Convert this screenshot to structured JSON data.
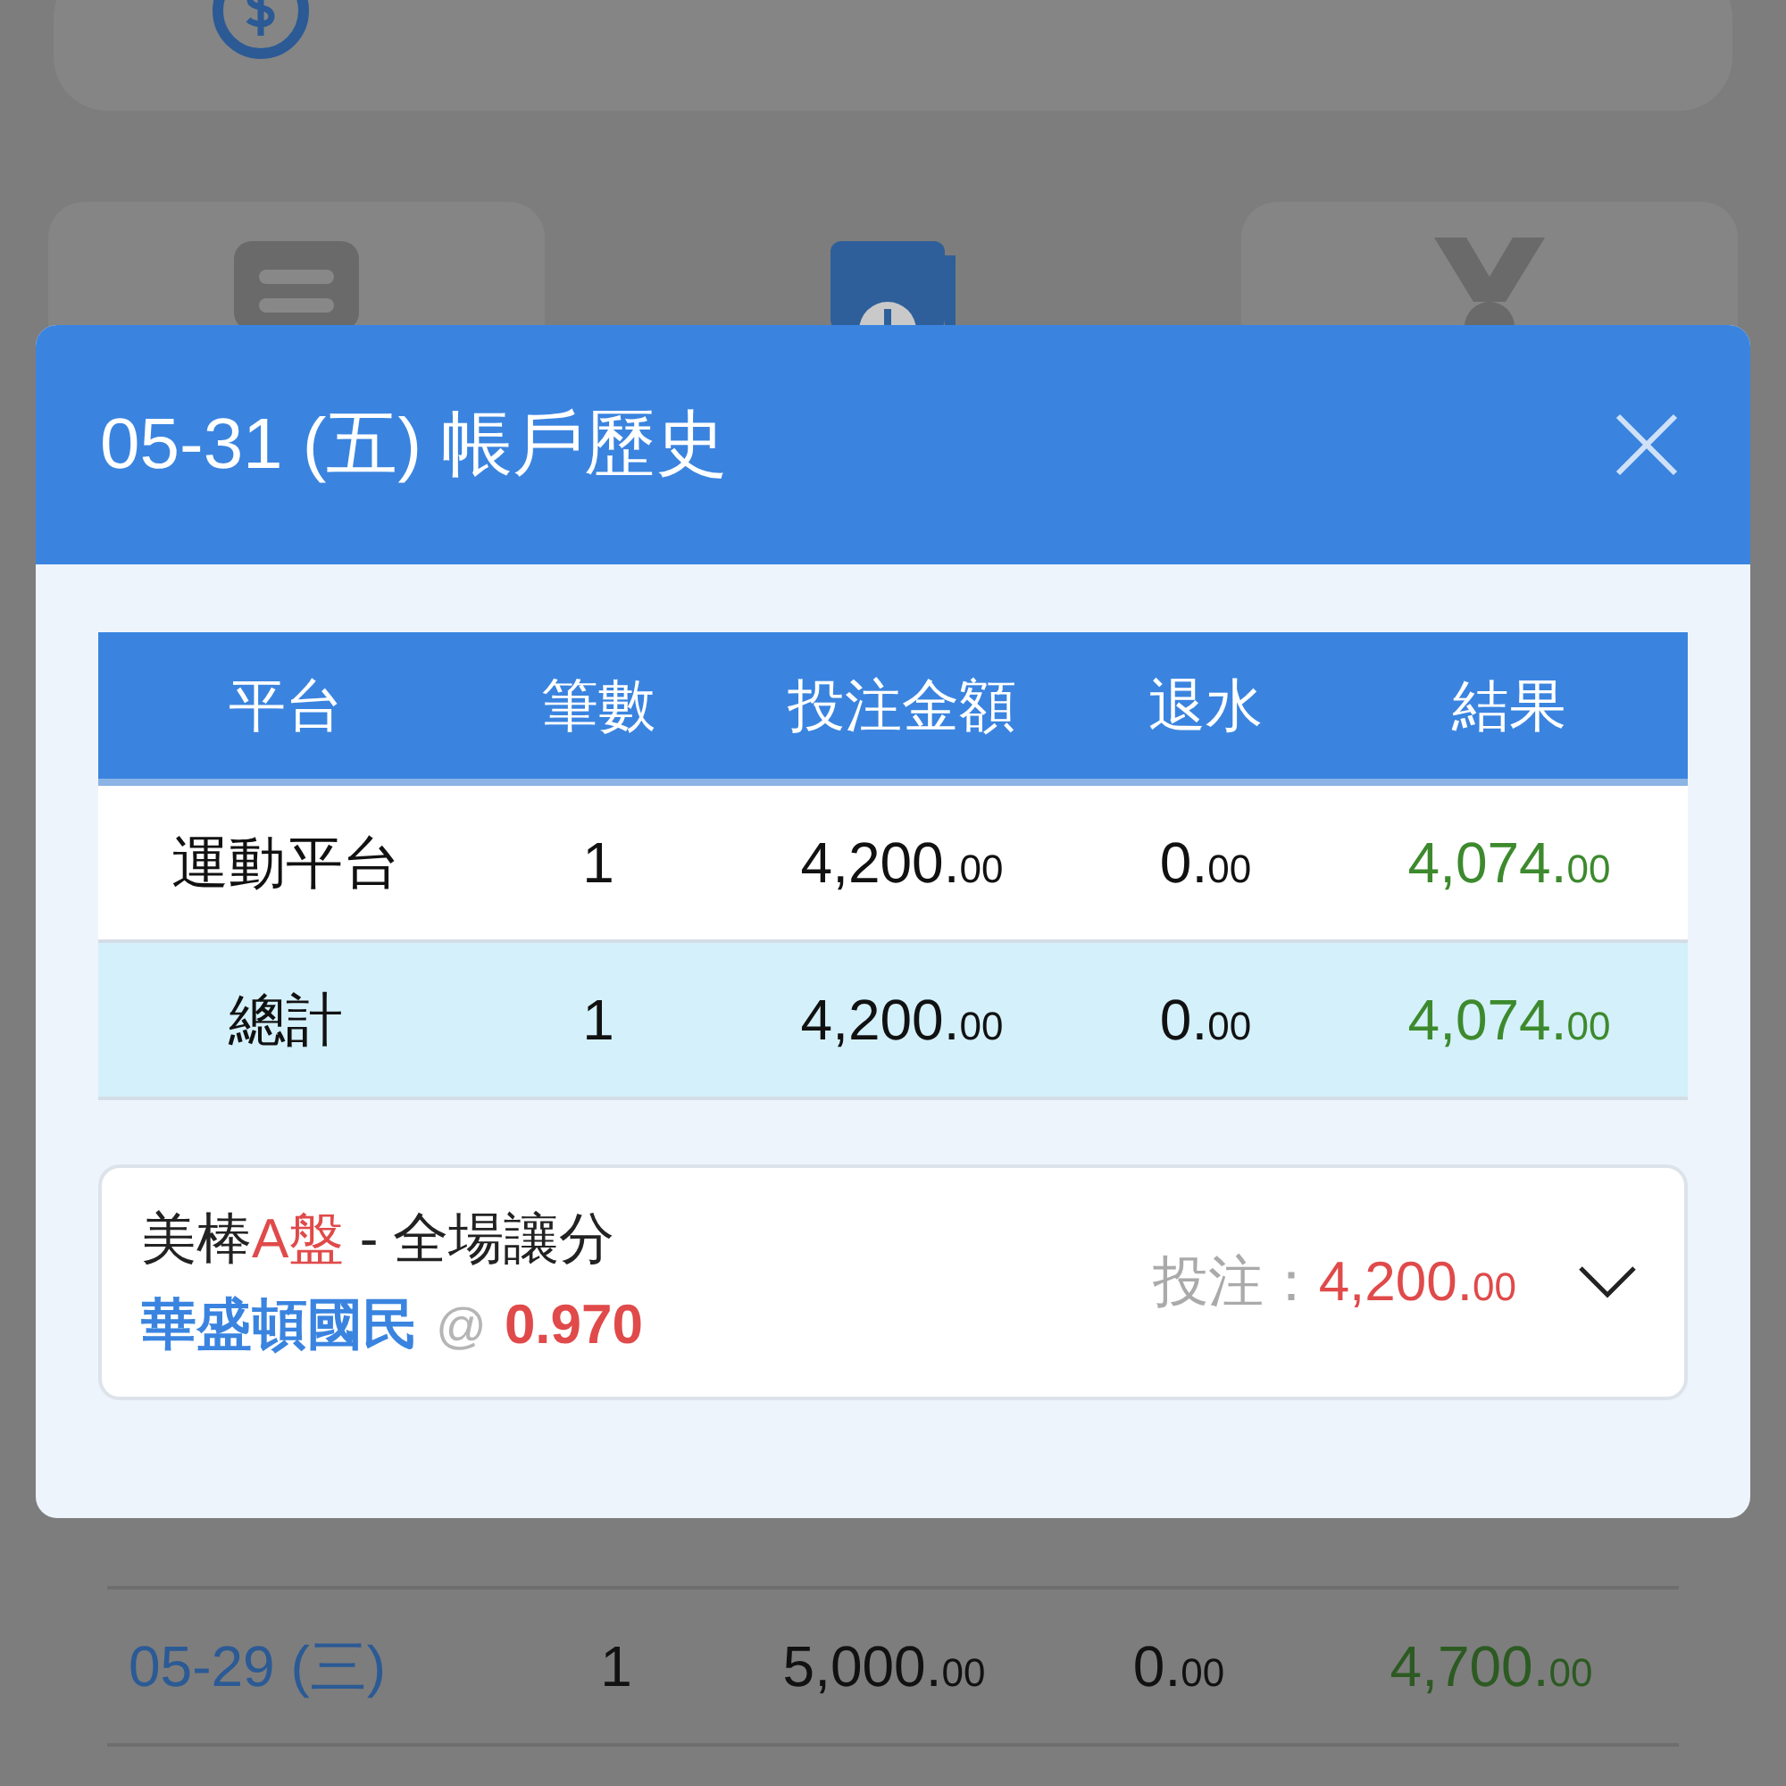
{
  "background": {
    "history_rows": [
      {
        "date": "05-29 (三)",
        "count": "1",
        "amount": "5,000.00",
        "rebate": "0.00",
        "result": "4,700.00",
        "color": "#2c5a22"
      }
    ]
  },
  "modal": {
    "title": "05-31 (五) 帳戶歷史",
    "table": {
      "columns": [
        "平台",
        "筆數",
        "投注金額",
        "退水",
        "結果"
      ],
      "rows": [
        {
          "kind": "platform",
          "platform": "運動平台",
          "count": "1",
          "amount": "4,200.00",
          "rebate": "0.00",
          "result": "4,074.00",
          "color": "#3d8a2e"
        },
        {
          "kind": "total",
          "platform": "總計",
          "count": "1",
          "amount": "4,200.00",
          "rebate": "0.00",
          "result": "4,074.00",
          "color": "#3d8a2e"
        }
      ]
    },
    "bets": [
      {
        "league_prefix": "美棒",
        "league_highlight": "A盤",
        "market": "- 全場讓分",
        "selection": "華盛頓國民",
        "at": "@",
        "odds": "0.970",
        "stake_label": "投注：",
        "stake": "4,200.00",
        "expanded": false
      }
    ]
  }
}
